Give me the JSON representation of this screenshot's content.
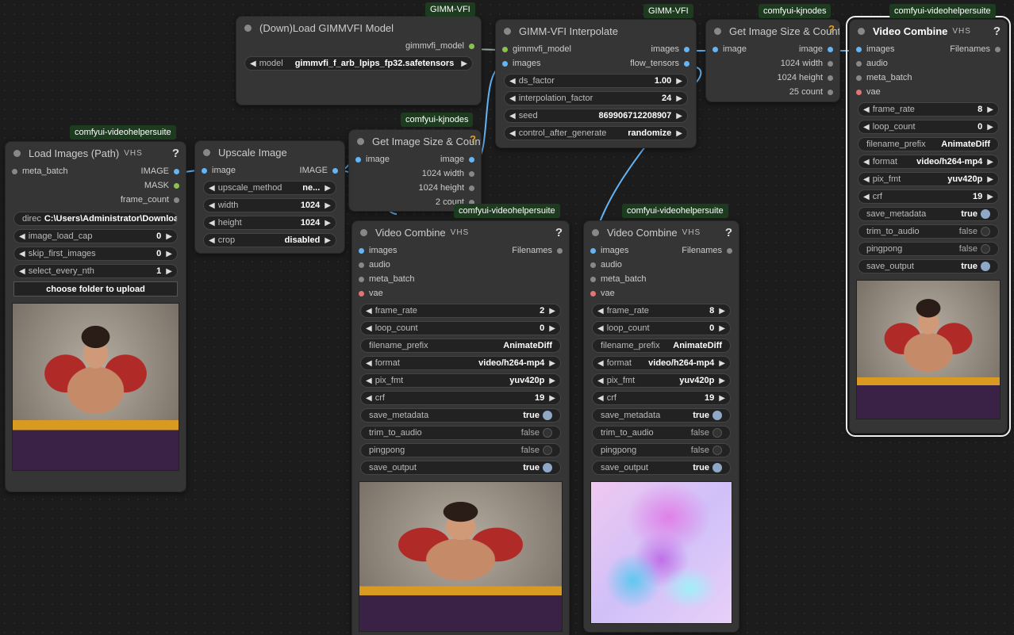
{
  "badges": {
    "gimmvfi_load": "GIMM-VFI",
    "gimmvfi_interp": "GIMM-VFI",
    "kjnodes_a": "comfyui-kjnodes",
    "kjnodes_b": "comfyui-kjnodes",
    "vhs_load": "comfyui-videohelpersuite",
    "vhs_vc1": "comfyui-videohelpersuite",
    "vhs_vc2": "comfyui-videohelpersuite",
    "vhs_vc3": "comfyui-videohelpersuite"
  },
  "load_model": {
    "title": "(Down)Load GIMMVFI Model",
    "out": "gimmvfi_model",
    "w_label": "model",
    "w_value": "gimmvfi_f_arb_lpips_fp32.safetensors"
  },
  "interp": {
    "title": "GIMM-VFI Interpolate",
    "in_model": "gimmvfi_model",
    "in_images": "images",
    "out_images": "images",
    "out_flow": "flow_tensors",
    "widgets": [
      {
        "label": "ds_factor",
        "value": "1.00"
      },
      {
        "label": "interpolation_factor",
        "value": "24"
      },
      {
        "label": "seed",
        "value": "869906712208907"
      },
      {
        "label": "control_after_generate",
        "value": "randomize"
      }
    ]
  },
  "size2": {
    "title": "Get Image Size & Count",
    "in": "image",
    "out": "image",
    "o1": "1024 width",
    "o2": "1024 height",
    "o3": "25 count"
  },
  "size1": {
    "title": "Get Image Size & Count",
    "in": "image",
    "out": "image",
    "o1": "1024 width",
    "o2": "1024 height",
    "o3": "2 count"
  },
  "load": {
    "title": "Load Images (Path)",
    "vhs": "VHS",
    "in": "meta_batch",
    "o1": "IMAGE",
    "o2": "MASK",
    "o3": "frame_count",
    "dir_label": "direc",
    "dir_value": "C:\\Users\\Administrator\\Downloa",
    "widgets": [
      {
        "label": "image_load_cap",
        "value": "0"
      },
      {
        "label": "skip_first_images",
        "value": "0"
      },
      {
        "label": "select_every_nth",
        "value": "1"
      }
    ],
    "button": "choose folder to upload"
  },
  "upscale": {
    "title": "Upscale Image",
    "in": "image",
    "out": "IMAGE",
    "widgets": [
      {
        "label": "upscale_method",
        "value": "ne..."
      },
      {
        "label": "width",
        "value": "1024"
      },
      {
        "label": "height",
        "value": "1024"
      },
      {
        "label": "crop",
        "value": "disabled"
      }
    ]
  },
  "vc_common": {
    "title": "Video Combine",
    "vhs": "VHS",
    "in_images": "images",
    "in_audio": "audio",
    "in_meta": "meta_batch",
    "in_vae": "vae",
    "out": "Filenames",
    "loop_label": "loop_count",
    "loop_value": "0",
    "fp_label": "filename_prefix",
    "fp_value": "AnimateDiff",
    "fmt_label": "format",
    "fmt_value": "video/h264-mp4",
    "pix_label": "pix_fmt",
    "pix_value": "yuv420p",
    "crf_label": "crf",
    "crf_value": "19",
    "fr_label": "frame_rate",
    "sm_label": "save_metadata",
    "sm_value": "true",
    "tta_label": "trim_to_audio",
    "tta_value": "false",
    "pp_label": "pingpong",
    "pp_value": "false",
    "so_label": "save_output",
    "so_value": "true"
  },
  "vc1": {
    "frame_rate": "2"
  },
  "vc2": {
    "frame_rate": "8"
  },
  "vc3": {
    "frame_rate": "8"
  }
}
